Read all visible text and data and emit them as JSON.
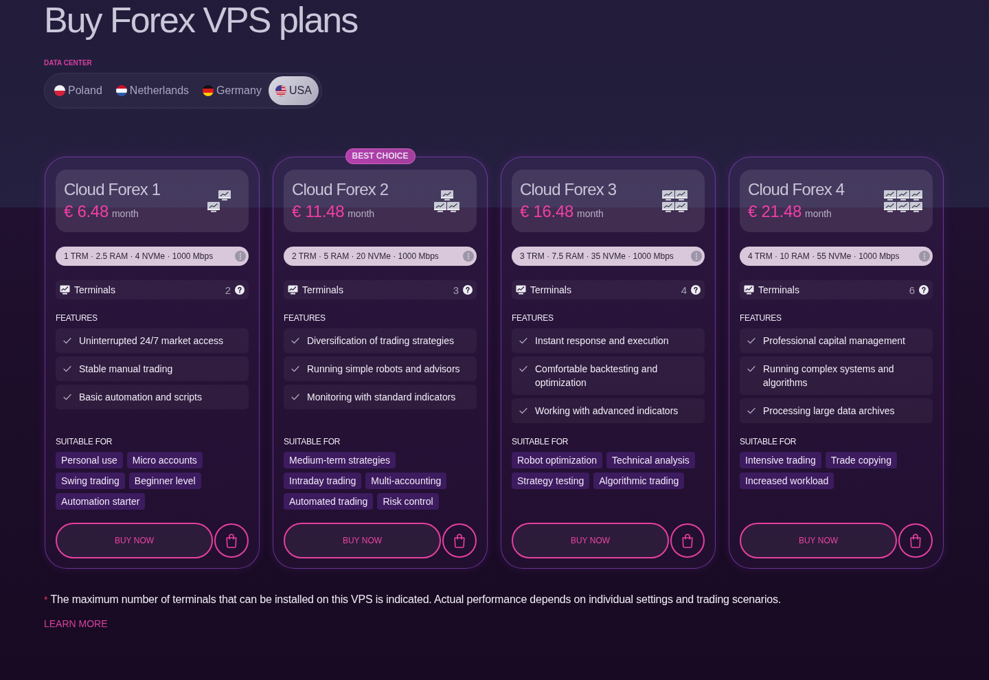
{
  "page": {
    "title": "Buy Forex VPS plans"
  },
  "data_center": {
    "label": "DATA CENTER",
    "tabs": [
      {
        "label": "Poland",
        "kind": "pl",
        "selected": false
      },
      {
        "label": "Netherlands",
        "kind": "nl",
        "selected": false
      },
      {
        "label": "Germany",
        "kind": "de",
        "selected": false
      },
      {
        "label": "USA",
        "kind": "us",
        "selected": true
      }
    ]
  },
  "plans": [
    {
      "name": "Cloud Forex 1",
      "price": "€ 6.48",
      "period": "month",
      "specs": "1 TRM · 2.5 RAM · 4 NVMe · 1000 Mbps",
      "terminals_label": "Terminals",
      "terminals": "2",
      "features_label": "FEATURES",
      "features": [
        "Uninterrupted 24/7 market access",
        "Stable manual trading",
        "Basic automation and scripts"
      ],
      "suitable_label": "SUITABLE FOR",
      "tag_rows": [
        [
          "Personal use",
          "Micro accounts"
        ],
        [
          "Swing trading",
          "Beginner level"
        ],
        [
          "Automation starter"
        ]
      ],
      "buy_label": "BUY NOW"
    },
    {
      "name": "Cloud Forex 2",
      "price": "€ 11.48",
      "period": "month",
      "badge": "BEST CHOICE",
      "specs": "2 TRM · 5 RAM · 20 NVMe · 1000 Mbps",
      "terminals_label": "Terminals",
      "terminals": "3",
      "features_label": "FEATURES",
      "features": [
        "Diversification of trading strategies",
        "Running simple robots and advisors",
        "Monitoring with standard indicators"
      ],
      "suitable_label": "SUITABLE FOR",
      "tag_rows": [
        [
          "Medium-term strategies"
        ],
        [
          "Intraday trading",
          "Multi-accounting"
        ],
        [
          "Automated trading",
          "Risk control"
        ]
      ],
      "buy_label": "BUY NOW"
    },
    {
      "name": "Cloud Forex 3",
      "price": "€ 16.48",
      "period": "month",
      "specs": "3 TRM · 7.5 RAM · 35 NVMe · 1000 Mbps",
      "terminals_label": "Terminals",
      "terminals": "4",
      "features_label": "FEATURES",
      "features": [
        "Instant response and execution",
        "Comfortable backtesting and optimization",
        "Working with advanced indicators"
      ],
      "suitable_label": "SUITABLE FOR",
      "tag_rows": [
        [
          "Robot optimization",
          "Technical analysis"
        ],
        [
          "Strategy testing",
          "Algorithmic trading"
        ]
      ],
      "buy_label": "BUY NOW"
    },
    {
      "name": "Cloud Forex 4",
      "price": "€ 21.48",
      "period": "month",
      "specs": "4 TRM · 10 RAM · 55 NVMe · 1000 Mbps",
      "terminals_label": "Terminals",
      "terminals": "6",
      "features_label": "FEATURES",
      "features": [
        "Professional capital management",
        "Running complex systems and algorithms",
        "Processing large data archives"
      ],
      "suitable_label": "SUITABLE FOR",
      "tag_rows": [
        [
          "Intensive trading",
          "Trade copying"
        ],
        [
          "Increased workload"
        ]
      ],
      "buy_label": "BUY NOW"
    }
  ],
  "note": {
    "mark": "*",
    "text": "The maximum number of terminals that can be installed on this VPS is indicated. Actual performance depends on individual settings and trading scenarios.",
    "link": "LEARN MORE"
  }
}
